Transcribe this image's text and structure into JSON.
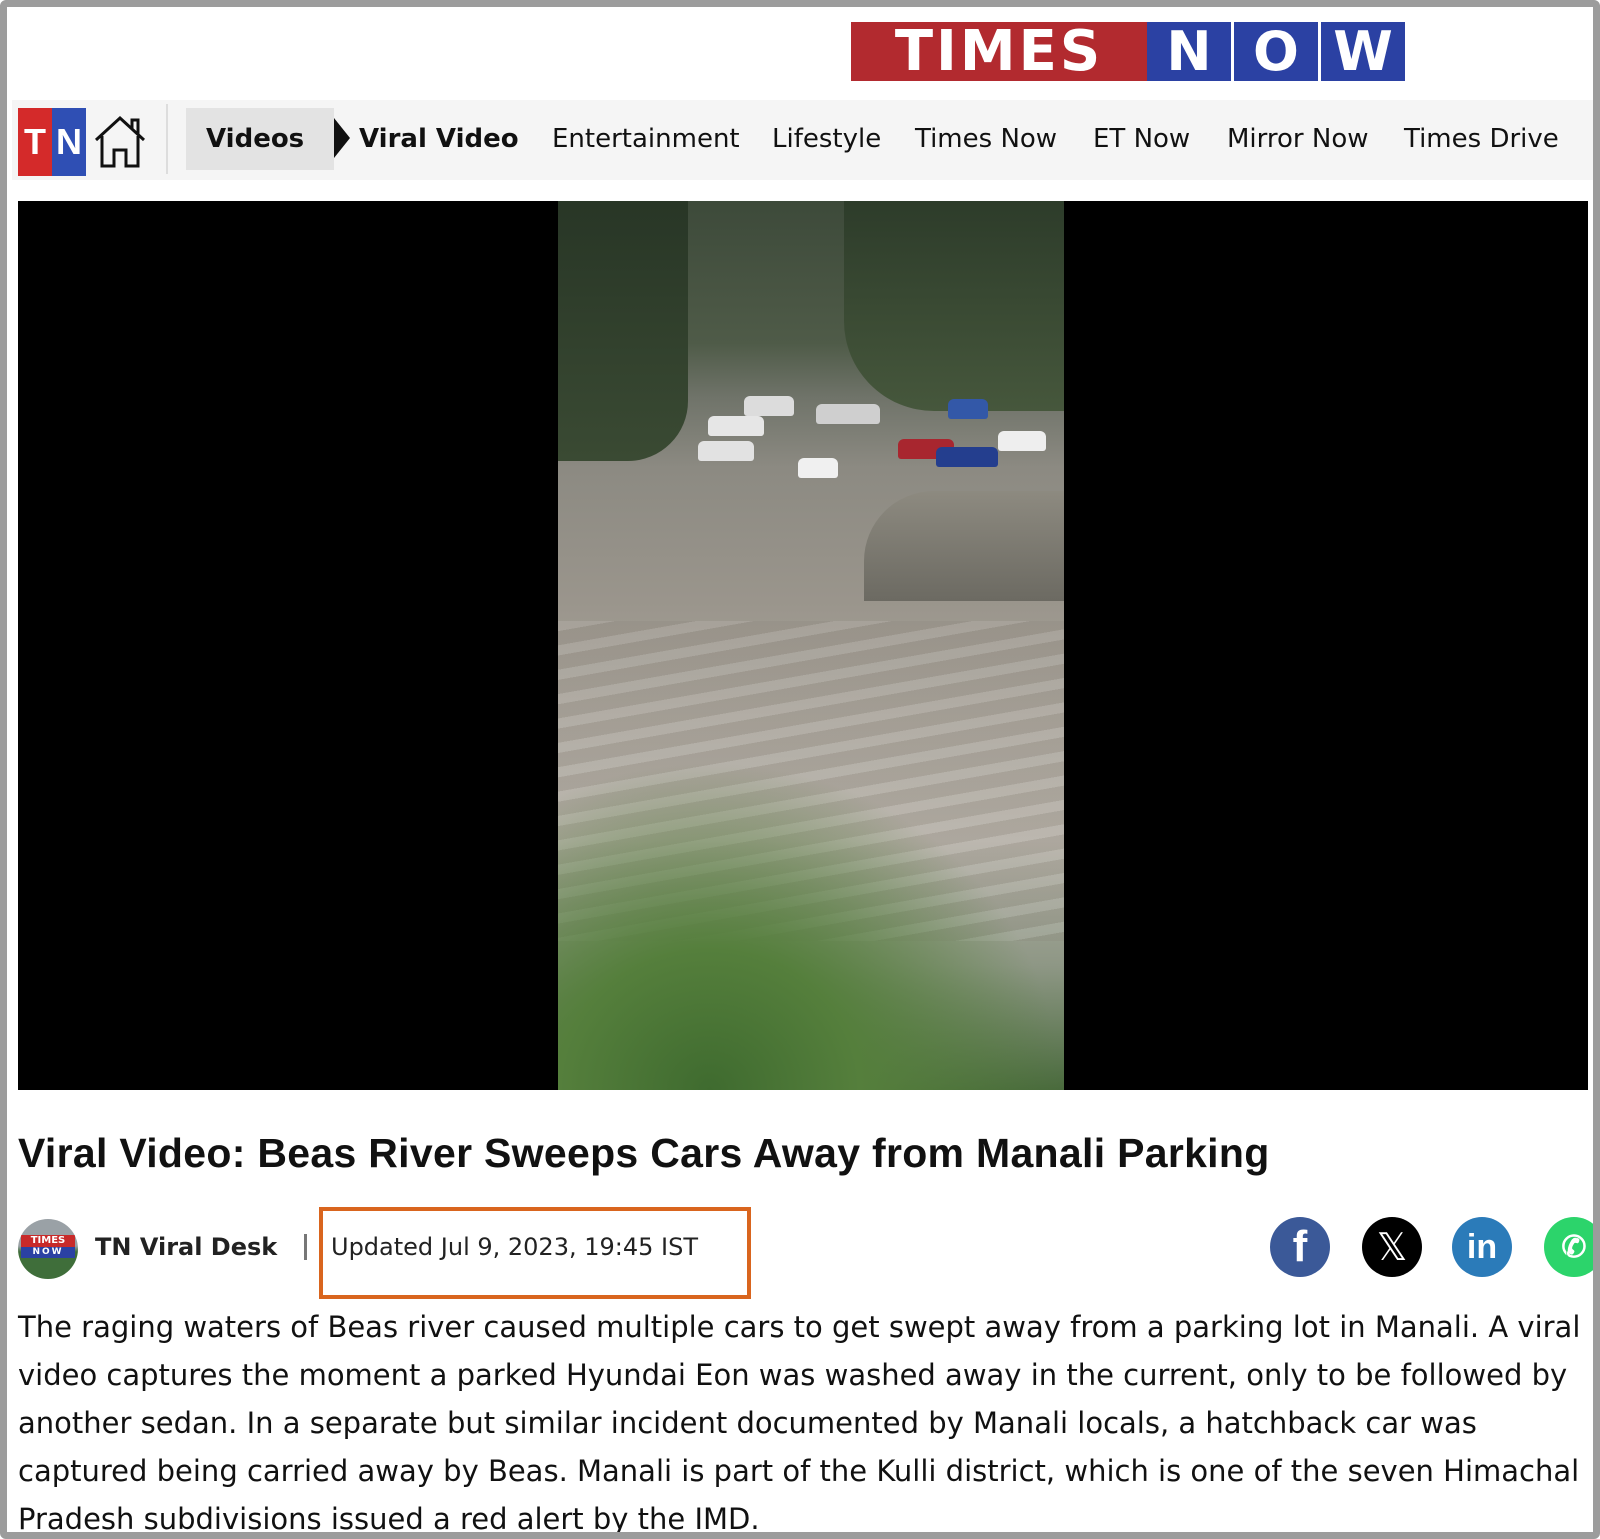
{
  "brand": {
    "times": "TIMES",
    "now_letters": [
      "N",
      "O",
      "W"
    ]
  },
  "nav": {
    "logo_t": "T",
    "logo_n": "N",
    "breadcrumb": "Videos",
    "current": "Viral Video",
    "items": [
      "Entertainment",
      "Lifestyle",
      "Times Now",
      "ET Now",
      "Mirror Now",
      "Times Drive"
    ]
  },
  "article": {
    "headline": "Viral Video: Beas River Sweeps Cars Away from Manali Parking",
    "author": "TN Viral Desk",
    "avatar_top": "TIMES",
    "avatar_bottom": "NOW",
    "updated": "Updated Jul 9, 2023, 19:45 IST",
    "body": "The raging waters of Beas river caused multiple cars to get swept away from a parking lot in Manali. A viral video captures the moment a parked Hyundai Eon was washed away in the current, only to be followed by another sedan. In a separate but similar incident documented by Manali locals, a hatchback car was captured being carried away by Beas. Manali is part of the Kulli district, which is one of the seven Himachal Pradesh subdivisions issued a red alert by the IMD."
  },
  "share": {
    "facebook": "f",
    "x": "𝕏",
    "linkedin": "in",
    "whatsapp": "✆"
  },
  "colors": {
    "times_red": "#b22a2f",
    "now_blue": "#2b41a3",
    "highlight_box": "#d9651e",
    "facebook": "#3b5998",
    "linkedin": "#2b7bb9",
    "whatsapp": "#2cd46b"
  },
  "icons": [
    "home-icon",
    "facebook-icon",
    "x-icon",
    "linkedin-icon",
    "whatsapp-icon"
  ]
}
